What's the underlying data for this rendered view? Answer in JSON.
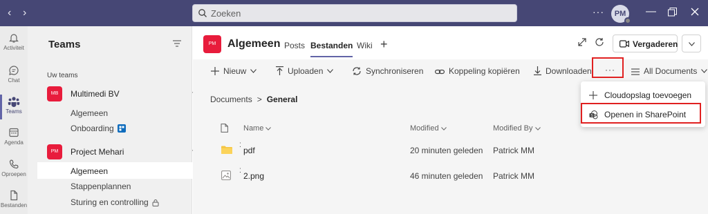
{
  "titlebar": {
    "search_placeholder": "Zoeken",
    "more_label": "···",
    "avatar_initials": "PM",
    "back_icon": "chevron-left-icon",
    "forward_icon": "chevron-right-icon"
  },
  "appbar": {
    "items": [
      {
        "label": "Activiteit",
        "icon": "bell-icon"
      },
      {
        "label": "Chat",
        "icon": "chat-icon"
      },
      {
        "label": "Teams",
        "icon": "teams-icon",
        "active": true
      },
      {
        "label": "Agenda",
        "icon": "calendar-icon"
      },
      {
        "label": "Oproepen",
        "icon": "phone-icon"
      },
      {
        "label": "Bestanden",
        "icon": "file-icon"
      }
    ]
  },
  "teams_panel": {
    "title": "Teams",
    "section_label": "Uw teams",
    "teams": [
      {
        "initials": "MB",
        "name": "Multimedi BV",
        "more": "···",
        "channels": [
          {
            "label": "Algemeen"
          },
          {
            "label": "Onboarding"
          }
        ]
      },
      {
        "initials": "PM",
        "name": "Project Mehari",
        "more": "···",
        "channels": [
          {
            "label": "Algemeen",
            "selected": true
          },
          {
            "label": "Stappenplannen"
          },
          {
            "label": "Sturing en controlling"
          }
        ]
      }
    ]
  },
  "channel_header": {
    "badge": "PM",
    "title": "Algemeen",
    "tabs": [
      {
        "label": "Posts"
      },
      {
        "label": "Bestanden",
        "active": true
      },
      {
        "label": "Wiki"
      }
    ],
    "meet_label": "Vergaderen"
  },
  "toolbar": {
    "new_label": "Nieuw",
    "upload_label": "Uploaden",
    "sync_label": "Synchroniseren",
    "copy_link_label": "Koppeling kopiëren",
    "download_label": "Downloaden",
    "more_label": "···",
    "view_label": "All Documents"
  },
  "breadcrumb": {
    "root": "Documents",
    "separator": ">",
    "current": "General"
  },
  "table": {
    "columns": [
      "Name",
      "Modified",
      "Modified By"
    ],
    "rows": [
      {
        "name": "pdf",
        "type": "folder",
        "modified": "20 minuten geleden",
        "modified_by": "Patrick MM"
      },
      {
        "name": "2.png",
        "type": "image",
        "modified": "46 minuten geleden",
        "modified_by": "Patrick MM"
      }
    ]
  },
  "more_menu": {
    "items": [
      {
        "label": "Cloudopslag toevoegen",
        "icon": "plus-icon"
      },
      {
        "label": "Openen in SharePoint",
        "icon": "sharepoint-icon"
      }
    ]
  },
  "colors": {
    "titlebar": "#464775",
    "accent": "#6264a7",
    "team_badge": "#e81c3c",
    "highlight": "#e02020"
  }
}
